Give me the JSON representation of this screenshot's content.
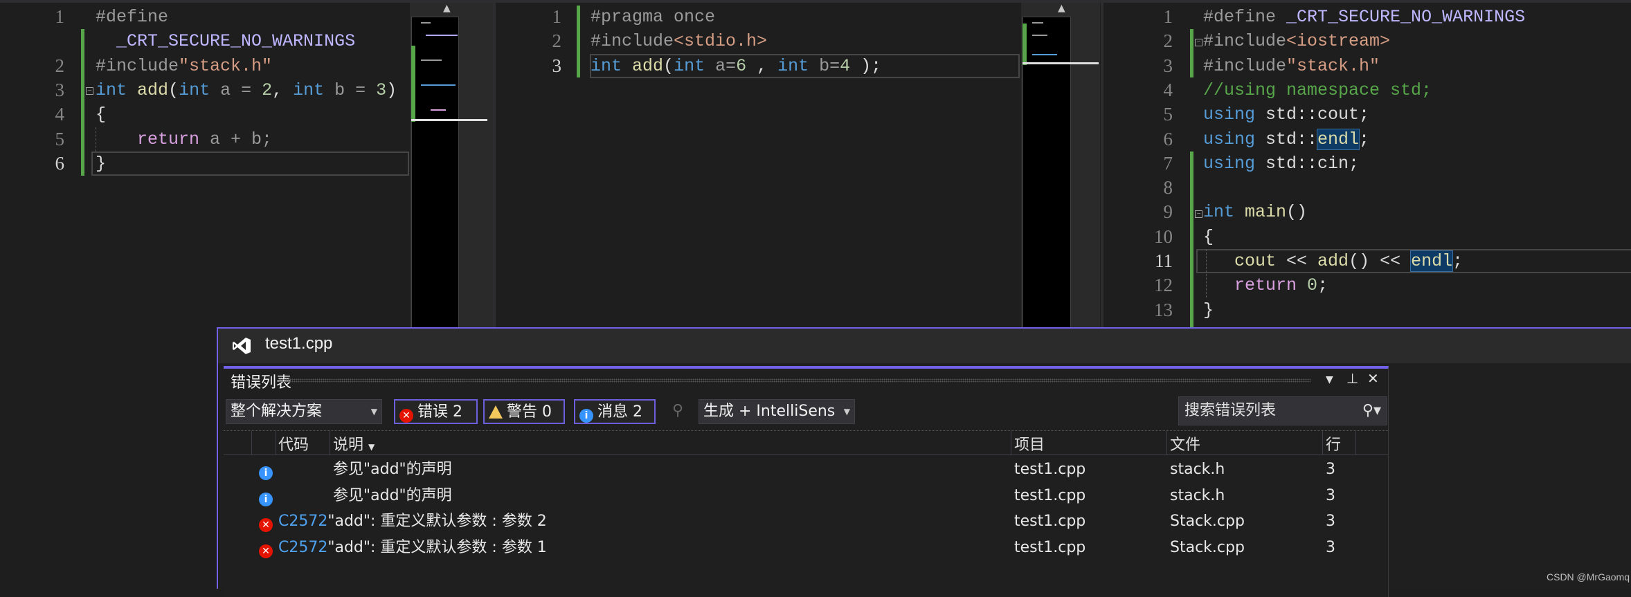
{
  "editors": [
    {
      "name": "editor-pane-test1",
      "lines": [
        {
          "num": "1",
          "tokens": [
            [
              "#define",
              "pp"
            ]
          ]
        },
        {
          "num": "",
          "tokens": [
            [
              "  ",
              "plain"
            ],
            [
              "_CRT_SECURE_NO_WARNINGS",
              "macro"
            ]
          ]
        },
        {
          "num": "2",
          "tokens": [
            [
              "#include",
              "pp"
            ],
            [
              "\"stack.h\"",
              "str"
            ]
          ]
        },
        {
          "num": "3",
          "tokens": [
            [
              "int",
              "kw"
            ],
            [
              " ",
              "plain"
            ],
            [
              "add",
              "fn"
            ],
            [
              "(",
              "plain"
            ],
            [
              "int",
              "kw"
            ],
            [
              " a = ",
              "param"
            ],
            [
              "2",
              "num"
            ],
            [
              ", ",
              "plain"
            ],
            [
              "int",
              "kw"
            ],
            [
              " b = ",
              "param"
            ],
            [
              "3",
              "num"
            ],
            [
              ")",
              "plain"
            ]
          ]
        },
        {
          "num": "4",
          "tokens": [
            [
              "{",
              "plain"
            ]
          ]
        },
        {
          "num": "5",
          "tokens": [
            [
              "    ",
              "plain"
            ],
            [
              "return",
              "ret"
            ],
            [
              " a + b;",
              "param"
            ]
          ]
        },
        {
          "num": "6",
          "tokens": [
            [
              "}",
              "plain"
            ]
          ],
          "current": true
        }
      ]
    },
    {
      "name": "editor-pane-stack-h",
      "lines": [
        {
          "num": "1",
          "tokens": [
            [
              "#pragma once",
              "pp"
            ]
          ]
        },
        {
          "num": "2",
          "tokens": [
            [
              "#include",
              "pp"
            ],
            [
              "<stdio.h>",
              "str"
            ]
          ]
        },
        {
          "num": "3",
          "tokens": [
            [
              "int",
              "kw"
            ],
            [
              " ",
              "plain"
            ],
            [
              "add",
              "fn"
            ],
            [
              "(",
              "plain"
            ],
            [
              "int",
              "kw"
            ],
            [
              " a=",
              "param"
            ],
            [
              "6",
              "num"
            ],
            [
              " , ",
              "plain"
            ],
            [
              "int",
              "kw"
            ],
            [
              " b=",
              "param"
            ],
            [
              "4",
              "num"
            ],
            [
              " );",
              "plain"
            ]
          ],
          "current": true
        }
      ]
    },
    {
      "name": "editor-pane-main",
      "lines": [
        {
          "num": "1",
          "tokens": [
            [
              "#define ",
              "pp"
            ],
            [
              "_CRT_SECURE_NO_WARNINGS",
              "macro"
            ]
          ]
        },
        {
          "num": "2",
          "tokens": [
            [
              "#include",
              "pp"
            ],
            [
              "<iostream>",
              "str"
            ]
          ]
        },
        {
          "num": "3",
          "tokens": [
            [
              "#include",
              "pp"
            ],
            [
              "\"stack.h\"",
              "str"
            ]
          ]
        },
        {
          "num": "4",
          "tokens": [
            [
              "//using namespace std;",
              "cm"
            ]
          ]
        },
        {
          "num": "5",
          "tokens": [
            [
              "using",
              "kw"
            ],
            [
              " std::cout;",
              "plain"
            ]
          ]
        },
        {
          "num": "6",
          "tokens": [
            [
              "using",
              "kw"
            ],
            [
              " std::",
              "plain"
            ],
            [
              "endl",
              "hl"
            ],
            [
              ";",
              "plain"
            ]
          ]
        },
        {
          "num": "7",
          "tokens": [
            [
              "using",
              "kw"
            ],
            [
              " std::cin;",
              "plain"
            ]
          ]
        },
        {
          "num": "8",
          "tokens": []
        },
        {
          "num": "9",
          "tokens": [
            [
              "int",
              "kw"
            ],
            [
              " ",
              "plain"
            ],
            [
              "main",
              "fn"
            ],
            [
              "()",
              "plain"
            ]
          ]
        },
        {
          "num": "10",
          "tokens": [
            [
              "{",
              "plain"
            ]
          ]
        },
        {
          "num": "11",
          "tokens": [
            [
              "   ",
              "plain"
            ],
            [
              "cout",
              "fn"
            ],
            [
              " << ",
              "plain"
            ],
            [
              "add",
              "fn"
            ],
            [
              "() << ",
              "plain"
            ],
            [
              "endl",
              "hl"
            ],
            [
              ";",
              "plain"
            ]
          ],
          "current": true
        },
        {
          "num": "12",
          "tokens": [
            [
              "   ",
              "plain"
            ],
            [
              "return",
              "ret"
            ],
            [
              " ",
              "plain"
            ],
            [
              "0",
              "num"
            ],
            [
              ";",
              "plain"
            ]
          ]
        },
        {
          "num": "13",
          "tokens": [
            [
              "}",
              "plain"
            ]
          ]
        }
      ]
    }
  ],
  "window": {
    "title": "test1.cpp",
    "accent": "#7160e8"
  },
  "error_list": {
    "title": "错误列表",
    "scope_dropdown": "整个解决方案",
    "errors_button": {
      "icon": "error-icon",
      "label": "错误 2"
    },
    "warnings_button": {
      "icon": "warning-icon",
      "label": "警告 0"
    },
    "messages_button": {
      "icon": "info-icon",
      "label": "消息 2"
    },
    "source_dropdown": "生成 + IntelliSens",
    "search_placeholder": "搜索错误列表",
    "columns": {
      "code": "代码",
      "description": "说明",
      "project": "项目",
      "file": "文件",
      "line": "行"
    },
    "rows": [
      {
        "type": "info",
        "code": "",
        "description": "参见\"add\"的声明",
        "project": "test1.cpp",
        "file": "stack.h",
        "line": "3"
      },
      {
        "type": "info",
        "code": "",
        "description": "参见\"add\"的声明",
        "project": "test1.cpp",
        "file": "stack.h",
        "line": "3"
      },
      {
        "type": "error",
        "code": "C2572",
        "description": "\"add\": 重定义默认参数 : 参数 2",
        "project": "test1.cpp",
        "file": "Stack.cpp",
        "line": "3"
      },
      {
        "type": "error",
        "code": "C2572",
        "description": "\"add\": 重定义默认参数 : 参数 1",
        "project": "test1.cpp",
        "file": "Stack.cpp",
        "line": "3"
      }
    ]
  },
  "watermark": "CSDN @MrGaomq"
}
